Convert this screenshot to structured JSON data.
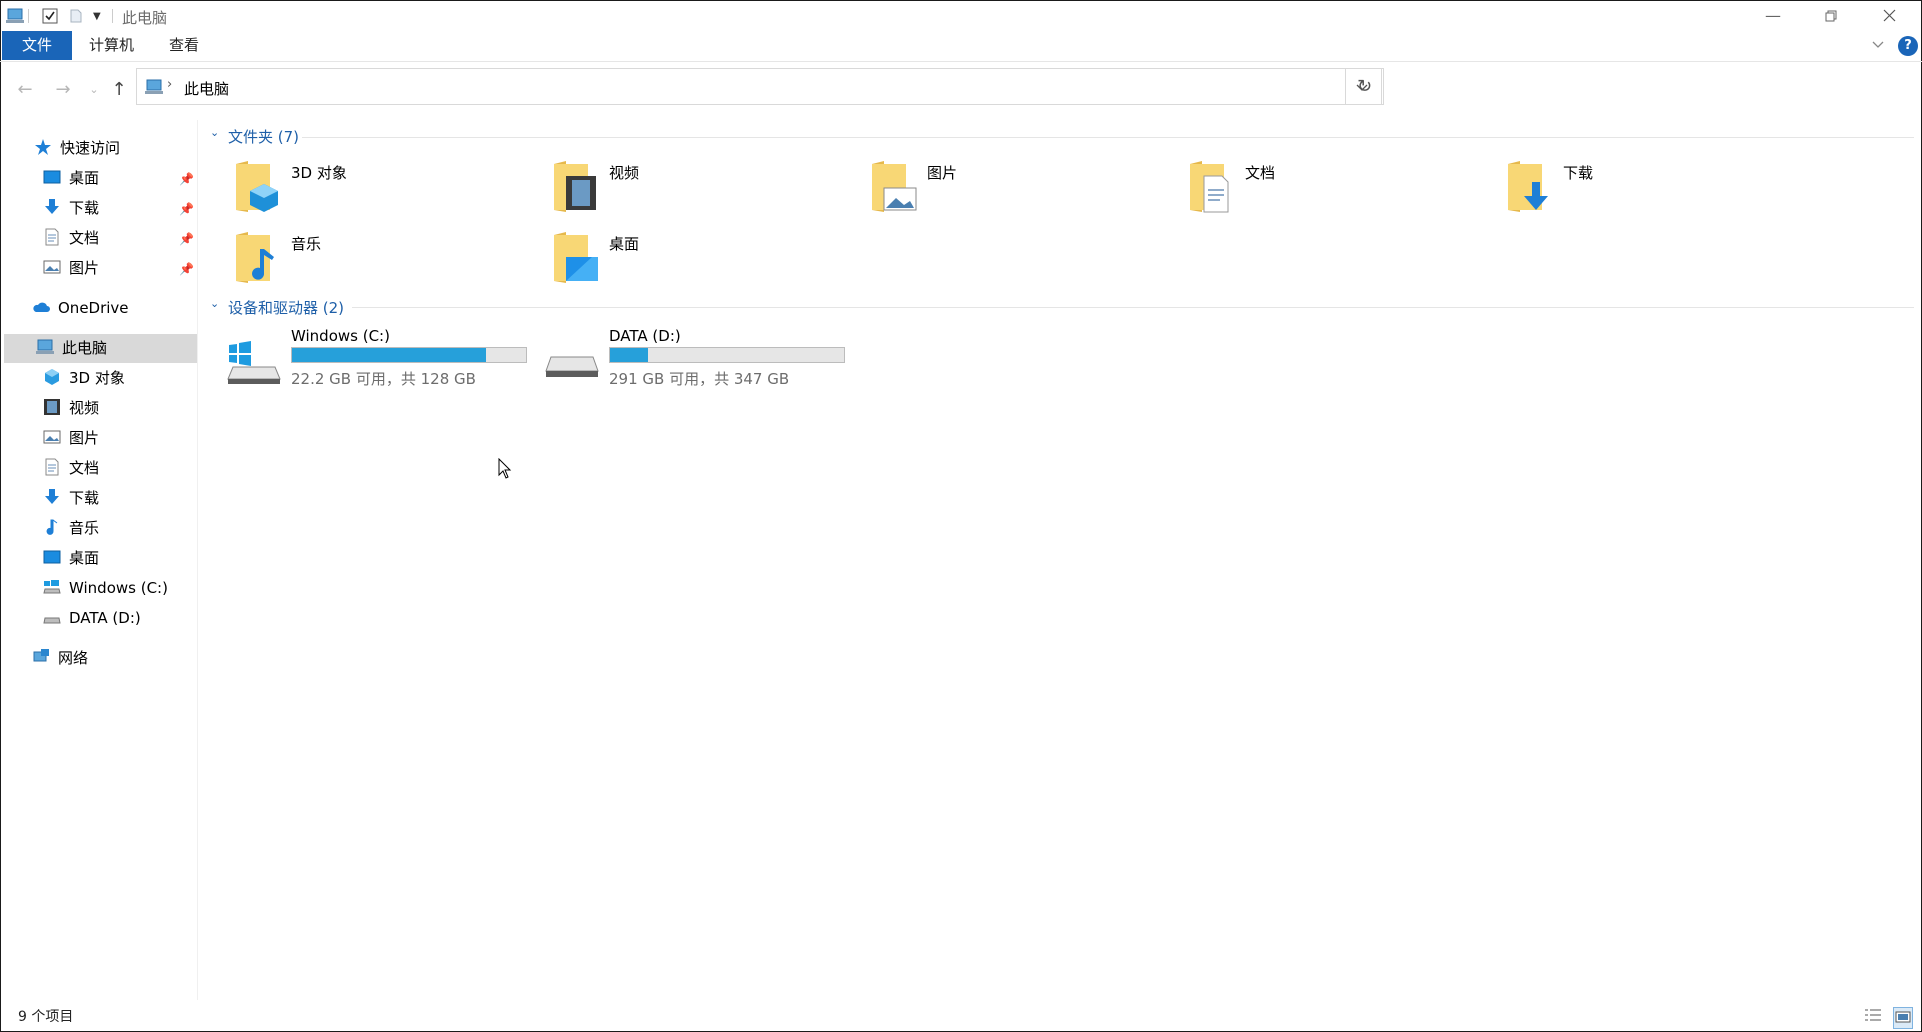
{
  "window": {
    "title": "此电脑",
    "controls": [
      "minimize-icon",
      "restore-icon",
      "close-icon"
    ]
  },
  "ribbon": {
    "tabs": [
      {
        "label": "文件",
        "active": true
      },
      {
        "label": "计算机",
        "active": false
      },
      {
        "label": "查看",
        "active": false
      }
    ]
  },
  "address": {
    "path": "此电脑"
  },
  "sidebar": {
    "quick_access": "快速访问",
    "quick_items": [
      {
        "label": "桌面",
        "icon": "desktop-icon"
      },
      {
        "label": "下载",
        "icon": "download-icon"
      },
      {
        "label": "文档",
        "icon": "document-icon"
      },
      {
        "label": "图片",
        "icon": "picture-icon"
      }
    ],
    "onedrive": "OneDrive",
    "this_pc": "此电脑",
    "pc_items": [
      {
        "label": "3D 对象",
        "icon": "3d-object-icon"
      },
      {
        "label": "视频",
        "icon": "video-icon"
      },
      {
        "label": "图片",
        "icon": "picture-icon"
      },
      {
        "label": "文档",
        "icon": "document-icon"
      },
      {
        "label": "下载",
        "icon": "download-icon"
      },
      {
        "label": "音乐",
        "icon": "music-icon"
      },
      {
        "label": "桌面",
        "icon": "desktop-icon"
      },
      {
        "label": "Windows (C:)",
        "icon": "windows-drive-icon"
      },
      {
        "label": "DATA (D:)",
        "icon": "drive-icon"
      }
    ],
    "network": "网络"
  },
  "main": {
    "folders_header": "文件夹 (7)",
    "folders": [
      {
        "label": "3D 对象",
        "icon": "3d-object-folder-icon"
      },
      {
        "label": "视频",
        "icon": "video-folder-icon"
      },
      {
        "label": "图片",
        "icon": "picture-folder-icon"
      },
      {
        "label": "文档",
        "icon": "document-folder-icon"
      },
      {
        "label": "下载",
        "icon": "download-folder-icon"
      },
      {
        "label": "音乐",
        "icon": "music-folder-icon"
      },
      {
        "label": "桌面",
        "icon": "desktop-folder-icon"
      }
    ],
    "drives_header": "设备和驱动器 (2)",
    "drives": [
      {
        "label": "Windows (C:)",
        "free_text": "22.2 GB 可用，共 128 GB",
        "used_fraction": 0.827,
        "icon": "windows-drive-icon"
      },
      {
        "label": "DATA (D:)",
        "free_text": "291 GB 可用，共 347 GB",
        "used_fraction": 0.161,
        "icon": "drive-icon"
      }
    ]
  },
  "status": {
    "item_count": "9 个项目"
  },
  "colors": {
    "accent": "#1a65b8",
    "section_header": "#1e5fa8",
    "drive_bar": "#26a0da",
    "folder_yellow": "#f8d775"
  }
}
